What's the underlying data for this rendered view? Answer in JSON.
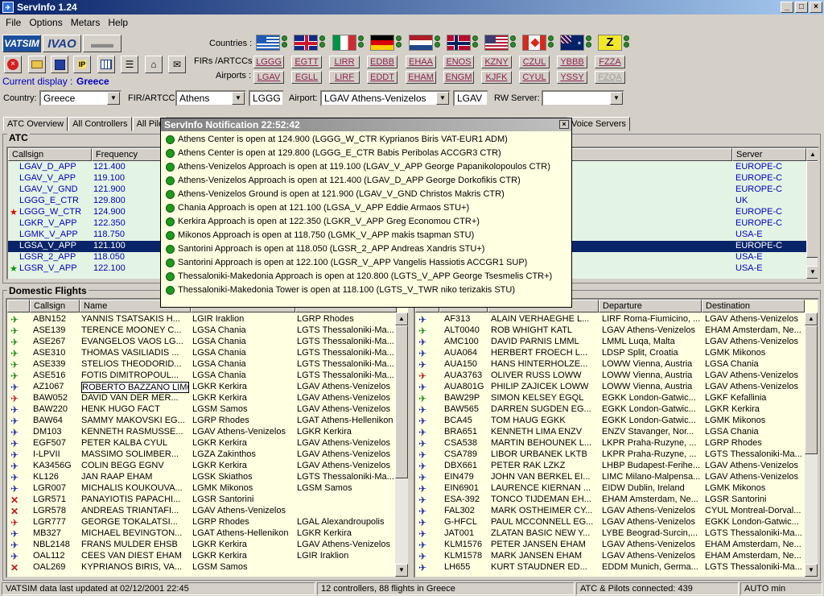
{
  "window": {
    "title": "ServInfo 1.24"
  },
  "menu": [
    "File",
    "Options",
    "Metars",
    "Help"
  ],
  "toolbar": {
    "vatsim": "VATSIM",
    "ivao": "IVAO",
    "current_display_label": "Current display :",
    "current_display_value": "Greece"
  },
  "countries_label": "Countries :",
  "firs_label": "FIRs /ARTCCs :",
  "airports_label": "Airports :",
  "fir_codes": [
    "LGGG",
    "EGTT",
    "LIRR",
    "EDBB",
    "EHAA",
    "ENOS",
    "KZNY",
    "CZUL",
    "YBBB",
    "FZZA"
  ],
  "airport_codes": [
    "LGAV",
    "EGLL",
    "LIRF",
    "EDDT",
    "EHAM",
    "ENGM",
    "KJFK",
    "CYUL",
    "YSSY",
    "FZQA"
  ],
  "filters": {
    "country_label": "Country:",
    "country_value": "Greece",
    "fir_label": "FIR/ARTCC:",
    "fir_value": "Athens",
    "fir_code": "LGGG",
    "airport_label": "Airport:",
    "airport_value": "LGAV Athens-Venizelos",
    "airport_code": "LGAV",
    "rw_label": "RW Server:",
    "rw_value": ""
  },
  "tabs": [
    "ATC Overview",
    "All Controllers",
    "All Pilo",
    "Voice Servers"
  ],
  "atc": {
    "title": "ATC",
    "headers": [
      "Callsign",
      "Frequency",
      "Server"
    ],
    "rows": [
      {
        "mark": "",
        "callsign": "LGAV_D_APP",
        "freq": "121.400",
        "server": "EUROPE-C"
      },
      {
        "mark": "",
        "callsign": "LGAV_V_APP",
        "freq": "119.100",
        "server": "EUROPE-C"
      },
      {
        "mark": "",
        "callsign": "LGAV_V_GND",
        "freq": "121.900",
        "server": "EUROPE-C"
      },
      {
        "mark": "",
        "callsign": "LGGG_E_CTR",
        "freq": "129.800",
        "server": "UK"
      },
      {
        "mark": "★",
        "callsign": "LGGG_W_CTR",
        "freq": "124.900",
        "server": "EUROPE-C"
      },
      {
        "mark": "",
        "callsign": "LGKR_V_APP",
        "freq": "122.350",
        "server": "EUROPE-C"
      },
      {
        "mark": "",
        "callsign": "LGMK_V_APP",
        "freq": "118.750",
        "server": "USA-E"
      },
      {
        "mark": "",
        "callsign": "LGSA_V_APP",
        "freq": "121.100",
        "server": "EUROPE-C",
        "selected": true
      },
      {
        "mark": "",
        "callsign": "LGSR_2_APP",
        "freq": "118.050",
        "server": "USA-E"
      },
      {
        "mark": "★",
        "callsign": "LGSR_V_APP",
        "freq": "122.100",
        "server": "USA-E"
      }
    ]
  },
  "notification": {
    "title": "ServInfo Notification  22:52:42",
    "lines": [
      "Athens Center is open at 124.900 (LGGG_W_CTR Kyprianos Biris VAT-EUR1 ADM)",
      "Athens Center is open at 129.800 (LGGG_E_CTR Babis Peribolas ACCGR3 CTR)",
      "Athens-Venizelos Approach is open at 119.100 (LGAV_V_APP George Papanikolopoulos CTR)",
      "Athens-Venizelos Approach is open at 121.400 (LGAV_D_APP George Dorkofikis CTR)",
      "Athens-Venizelos Ground is open at 121.900 (LGAV_V_GND Christos Makris CTR)",
      "Chania Approach is open at 121.100 (LGSA_V_APP Eddie Armaos STU+)",
      "Kerkira Approach is open at 122.350 (LGKR_V_APP Greg Economou CTR+)",
      "Mikonos Approach is open at 118.750 (LGMK_V_APP makis tsapman STU)",
      "Santorini Approach is open at 118.050 (LGSR_2_APP Andreas Xandris STU+)",
      "Santorini Approach is open at 122.100 (LGSR_V_APP Vangelis Hassiotis ACCGR1 SUP)",
      "Thessaloniki-Makedonia Approach is open at 120.800 (LGTS_V_APP George Tsesmelis CTR+)",
      "Thessaloniki-Makedonia Tower is open at 118.100 (LGTS_V_TWR niko terizakis STU)"
    ]
  },
  "domestic": {
    "title": "Domestic Flights",
    "headers": [
      "Callsign",
      "Name"
    ],
    "rows": [
      {
        "icon": "green",
        "callsign": "ABN152",
        "name": "YANNIS TSATSAKIS H...",
        "dep": "LGIR Iraklion",
        "dest": "LGRP Rhodes"
      },
      {
        "icon": "green",
        "callsign": "ASE139",
        "name": "TERENCE MOONEY C...",
        "dep": "LGSA Chania",
        "dest": "LGTS Thessaloniki-Ma..."
      },
      {
        "icon": "green",
        "callsign": "ASE267",
        "name": "EVANGELOS VAOS LG...",
        "dep": "LGSA Chania",
        "dest": "LGTS Thessaloniki-Ma..."
      },
      {
        "icon": "green",
        "callsign": "ASE310",
        "name": "THOMAS VASILIADIS ...",
        "dep": "LGSA Chania",
        "dest": "LGTS Thessaloniki-Ma..."
      },
      {
        "icon": "green",
        "callsign": "ASE339",
        "name": "STELIOS THEODORID...",
        "dep": "LGSA Chania",
        "dest": "LGTS Thessaloniki-Ma..."
      },
      {
        "icon": "green",
        "callsign": "ASE516",
        "name": "FOTIS DIMITROPOUL...",
        "dep": "LGSA Chania",
        "dest": "LGTS Thessaloniki-Ma..."
      },
      {
        "icon": "blue",
        "callsign": "AZ1067",
        "name": "ROBERTO BAZZANO LIMC",
        "dep": "LGKR Kerkira",
        "dest": "LGAV Athens-Venizelos",
        "boxed": true
      },
      {
        "icon": "red",
        "callsign": "BAW052",
        "name": "DAVID VAN DER MER...",
        "dep": "LGKR Kerkira",
        "dest": "LGAV Athens-Venizelos"
      },
      {
        "icon": "blue",
        "callsign": "BAW220",
        "name": "HENK HUGO FACT",
        "dep": "LGSM Samos",
        "dest": "LGAV Athens-Venizelos"
      },
      {
        "icon": "blue",
        "callsign": "BAW64",
        "name": "SAMMY MAKOVSKI EG...",
        "dep": "LGRP Rhodes",
        "dest": "LGAT Athens-Hellenikon"
      },
      {
        "icon": "blue",
        "callsign": "DM103",
        "name": "KENNETH RASMUSSE...",
        "dep": "LGAV Athens-Venizelos",
        "dest": "LGKR Kerkira"
      },
      {
        "icon": "blue",
        "callsign": "EGF507",
        "name": "PETER KALBA CYUL",
        "dep": "LGKR Kerkira",
        "dest": "LGAV Athens-Venizelos"
      },
      {
        "icon": "blue",
        "callsign": "I-LPVII",
        "name": "MASSIMO SOLIMBER...",
        "dep": "LGZA Zakinthos",
        "dest": "LGAV Athens-Venizelos"
      },
      {
        "icon": "blue",
        "callsign": "KA3456G",
        "name": "COLIN BEGG EGNV",
        "dep": "LGKR Kerkira",
        "dest": "LGAV Athens-Venizelos"
      },
      {
        "icon": "blue",
        "callsign": "KL126",
        "name": "JAN RAAP EHAM",
        "dep": "LGSK Skiathos",
        "dest": "LGTS Thessaloniki-Ma..."
      },
      {
        "icon": "blue",
        "callsign": "LGR007",
        "name": "MICHALIS KOUKOUVA...",
        "dep": "LGMK Mikonos",
        "dest": "LGSM Samos"
      },
      {
        "icon": "cross",
        "callsign": "LGR571",
        "name": "PANAYIOTIS PAPACHI...",
        "dep": "LGSR Santorini",
        "dest": ""
      },
      {
        "icon": "cross",
        "callsign": "LGR578",
        "name": "ANDREAS TRIANTAFI...",
        "dep": "LGAV Athens-Venizelos",
        "dest": ""
      },
      {
        "icon": "red",
        "callsign": "LGR777",
        "name": "GEORGE TOKALATSI...",
        "dep": "LGRP Rhodes",
        "dest": "LGAL Alexandroupolis"
      },
      {
        "icon": "blue",
        "callsign": "MB327",
        "name": "MICHAEL BEVINGTON...",
        "dep": "LGAT Athens-Hellenikon",
        "dest": "LGKR Kerkira"
      },
      {
        "icon": "blue",
        "callsign": "NBL2148",
        "name": "FRANS MULDER EHSB",
        "dep": "LGKR Kerkira",
        "dest": "LGAV Athens-Venizelos"
      },
      {
        "icon": "blue",
        "callsign": "OAL112",
        "name": "CEES VAN DIEST EHAM",
        "dep": "LGKR Kerkira",
        "dest": "LGIR Iraklion"
      },
      {
        "icon": "cross",
        "callsign": "OAL269",
        "name": "KYPRIANOS BIRIS, VA...",
        "dep": "LGSM Samos",
        "dest": ""
      }
    ]
  },
  "intl": {
    "headers": [
      "Departure",
      "Destination"
    ],
    "rows": [
      {
        "icon": "blue",
        "callsign": "AF313",
        "name": "ALAIN VERHAEGHE L...",
        "dep": "LIRF Roma-Fiumicino, ...",
        "dest": "LGAV Athens-Venizelos"
      },
      {
        "icon": "green",
        "callsign": "ALT0040",
        "name": "ROB WHIGHT KATL",
        "dep": "LGAV Athens-Venizelos",
        "dest": "EHAM Amsterdam, Ne..."
      },
      {
        "icon": "blue",
        "callsign": "AMC100",
        "name": "DAVID PARNIS LMML",
        "dep": "LMML Luqa, Malta",
        "dest": "LGAV Athens-Venizelos"
      },
      {
        "icon": "blue",
        "callsign": "AUA064",
        "name": "HERBERT FROECH L...",
        "dep": "LDSP Split, Croatia",
        "dest": "LGMK Mikonos"
      },
      {
        "icon": "blue",
        "callsign": "AUA150",
        "name": "HANS HINTERHOLZE...",
        "dep": "LOWW Vienna, Austria",
        "dest": "LGSA Chania"
      },
      {
        "icon": "red",
        "callsign": "AUA3763",
        "name": "OLIVER RUSS LOWW",
        "dep": "LOWW Vienna, Austria",
        "dest": "LGAV Athens-Venizelos"
      },
      {
        "icon": "blue",
        "callsign": "AUA801G",
        "name": "PHILIP ZAJICEK LOWW",
        "dep": "LOWW Vienna, Austria",
        "dest": "LGAV Athens-Venizelos"
      },
      {
        "icon": "green",
        "callsign": "BAW29P",
        "name": "SIMON KELSEY EGQL",
        "dep": "EGKK London-Gatwic...",
        "dest": "LGKF Kefallinia"
      },
      {
        "icon": "blue",
        "callsign": "BAW565",
        "name": "DARREN SUGDEN EG...",
        "dep": "EGKK London-Gatwic...",
        "dest": "LGKR Kerkira"
      },
      {
        "icon": "blue",
        "callsign": "BCA45",
        "name": "TOM HAUG EGKK",
        "dep": "EGKK London-Gatwic...",
        "dest": "LGMK Mikonos"
      },
      {
        "icon": "blue",
        "callsign": "BRA651",
        "name": "KENNETH LIMA ENZV",
        "dep": "ENZV Stavanger, Nor...",
        "dest": "LGSA Chania"
      },
      {
        "icon": "blue",
        "callsign": "CSA538",
        "name": "MARTIN BEHOUNEK L...",
        "dep": "LKPR Praha-Ruzyne, ...",
        "dest": "LGRP Rhodes"
      },
      {
        "icon": "blue",
        "callsign": "CSA789",
        "name": "LIBOR URBANEK LKTB",
        "dep": "LKPR Praha-Ruzyne, ...",
        "dest": "LGTS Thessaloniki-Ma..."
      },
      {
        "icon": "blue",
        "callsign": "DBX661",
        "name": "PETER RAK LZKZ",
        "dep": "LHBP Budapest-Ferihe...",
        "dest": "LGAV Athens-Venizelos"
      },
      {
        "icon": "blue",
        "callsign": "EIN479",
        "name": "JOHN VAN BERKEL EI...",
        "dep": "LIMC Milano-Malpensa...",
        "dest": "LGAV Athens-Venizelos"
      },
      {
        "icon": "blue",
        "callsign": "EIN6901",
        "name": "LAURENCE KIERNAN ...",
        "dep": "EIDW Dublin, Ireland",
        "dest": "LGMK Mikonos"
      },
      {
        "icon": "blue",
        "callsign": "ESA-392",
        "name": "TONCO TIJDEMAN EH...",
        "dep": "EHAM Amsterdam, Ne...",
        "dest": "LGSR Santorini"
      },
      {
        "icon": "blue",
        "callsign": "FAL302",
        "name": "MARK OSTHEIMER CY...",
        "dep": "LGAV Athens-Venizelos",
        "dest": "CYUL Montreal-Dorval..."
      },
      {
        "icon": "blue",
        "callsign": "G-HFCL",
        "name": "PAUL MCCONNELL EG...",
        "dep": "LGAV Athens-Venizelos",
        "dest": "EGKK London-Gatwic..."
      },
      {
        "icon": "blue",
        "callsign": "JAT001",
        "name": "ZLATAN BASIC NEW Y...",
        "dep": "LYBE Beograd-Surcin,...",
        "dest": "LGTS Thessaloniki-Ma..."
      },
      {
        "icon": "blue",
        "callsign": "KLM1576",
        "name": "PETER JANSEN EHAM",
        "dep": "LGAV Athens-Venizelos",
        "dest": "EHAM Amsterdam, Ne..."
      },
      {
        "icon": "blue",
        "callsign": "KLM1578",
        "name": "MARK JANSEN EHAM",
        "dep": "LGAV Athens-Venizelos",
        "dest": "EHAM Amsterdam, Ne..."
      },
      {
        "icon": "blue",
        "callsign": "LH655",
        "name": "KURT STAUDNER ED...",
        "dep": "EDDM Munich, Germa...",
        "dest": "LGTS Thessaloniki-Ma..."
      }
    ]
  },
  "statusbar": {
    "updated": "VATSIM data last updated at 02/12/2001 22:45",
    "summary": "12 controllers, 88 flights in Greece",
    "connected": "ATC & Pilots connected: 439",
    "auto": "AUTO min"
  }
}
